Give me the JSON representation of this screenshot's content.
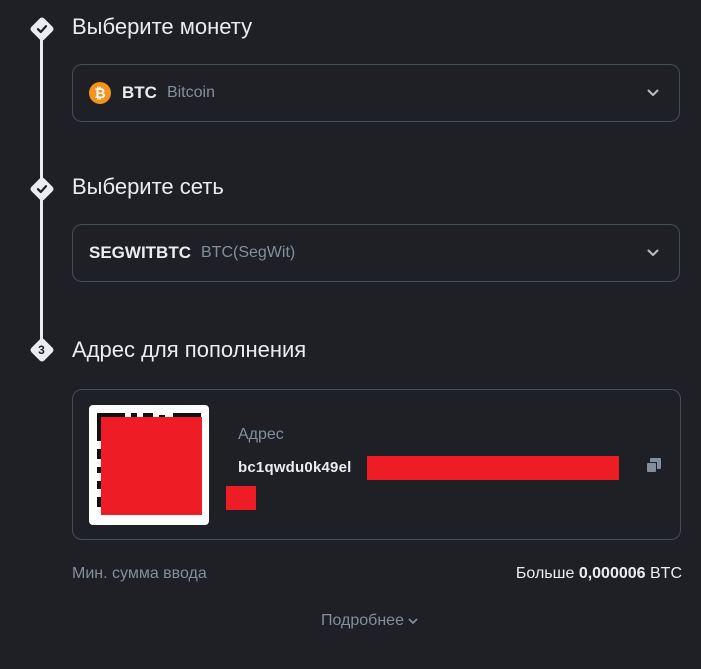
{
  "steps": [
    {
      "marker": "check",
      "title": "Выберите монету"
    },
    {
      "marker": "check",
      "title": "Выберите сеть"
    },
    {
      "marker": "3",
      "title": "Адрес для пополнения"
    }
  ],
  "coin": {
    "icon_glyph": "₿",
    "symbol": "BTC",
    "name": "Bitcoin",
    "icon_color": "#f7931a"
  },
  "network": {
    "code": "SEGWITBTC",
    "name": "BTC(SegWit)"
  },
  "deposit": {
    "address_label": "Адрес",
    "address_prefix": "bc1qwdu0k49el"
  },
  "min_amount": {
    "label": "Мин. сумма ввода",
    "prefix": "Больше ",
    "value": "0,000006",
    "unit": " BTC"
  },
  "more": {
    "label": "Подробнее"
  },
  "colors": {
    "background": "#1e2026",
    "border": "#474d57",
    "text_primary": "#eaecef",
    "text_secondary": "#848e9c",
    "redaction": "#ee1c25"
  }
}
